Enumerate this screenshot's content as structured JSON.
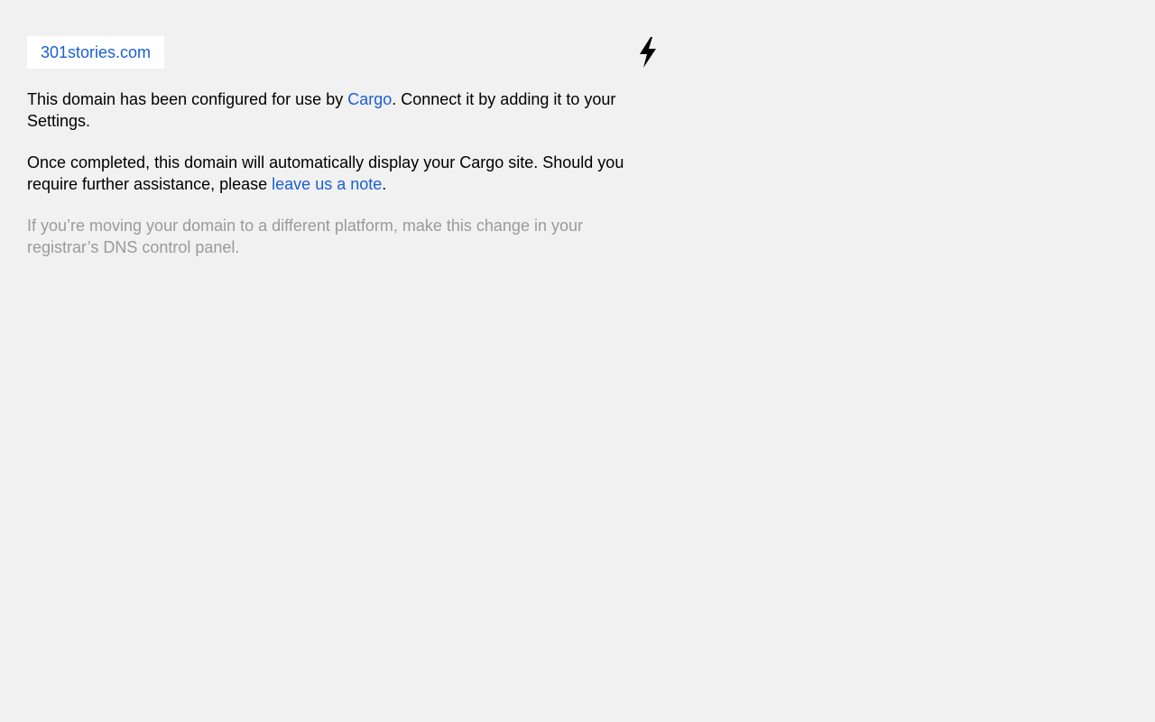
{
  "header": {
    "domain": "301stories.com",
    "bolt_icon": "lightning-bolt-icon"
  },
  "message": {
    "p1_before": "This domain has been configured for use by ",
    "p1_link": "Cargo",
    "p1_after": ". Connect it by adding it to your Settings.",
    "p2_before": "Once completed, this domain will automatically display your Cargo site. Should you require further assistance, please ",
    "p2_link": "leave us a note",
    "p2_after": ".",
    "p3": "If you’re moving your domain to a different platform, make this change in your registrar’s DNS control panel."
  },
  "colors": {
    "background": "#f1f1f1",
    "link": "#1a5fd6",
    "muted_text": "#9a9a9a",
    "pill_background": "#ffffff"
  }
}
